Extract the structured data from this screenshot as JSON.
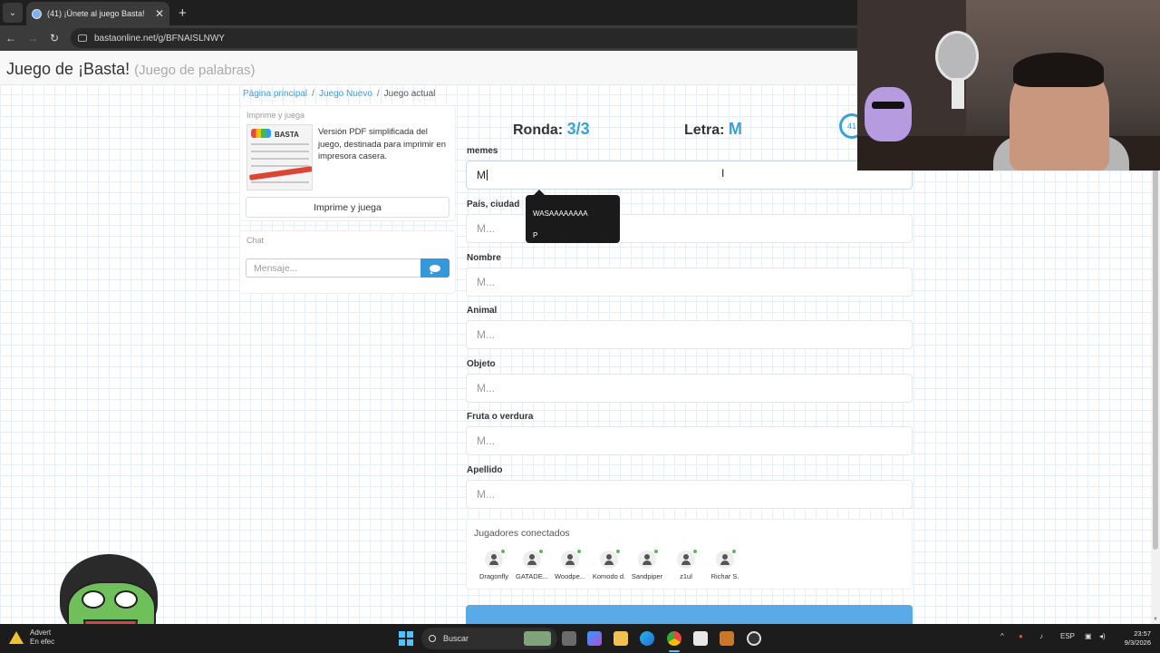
{
  "browser": {
    "tab_title": "(41) ¡Únete al juego Basta!",
    "url": "bastaonline.net/g/BFNAISLNWY",
    "tab_close": "✕",
    "tab_new": "+",
    "back": "←",
    "forward": "→",
    "reload": "↻",
    "menu": "⌄"
  },
  "site": {
    "title": "Juego de ¡Basta!",
    "subtitle": "(Juego de palabras)"
  },
  "breadcrumb": {
    "home": "Página principal",
    "new_game": "Juego Nuevo",
    "current": "Juego actual",
    "separator": "/"
  },
  "print_panel": {
    "heading": "Imprime y juega",
    "thumb_title": "BASTA",
    "description": "Versión PDF simplificada del juego, destinada para imprimir en impresora casera.",
    "button": "Imprime y juega"
  },
  "chat": {
    "heading": "Chat",
    "placeholder": "Mensaje..."
  },
  "game": {
    "round_label": "Ronda:",
    "round_value": "3/3",
    "letter_label": "Letra:",
    "letter_value": "M",
    "timer": "41"
  },
  "fields": [
    {
      "label": "memes",
      "value": "M",
      "placeholder": "M..."
    },
    {
      "label": "País, ciudad",
      "value": "",
      "placeholder": "M..."
    },
    {
      "label": "Nombre",
      "value": "",
      "placeholder": "M..."
    },
    {
      "label": "Animal",
      "value": "",
      "placeholder": "M..."
    },
    {
      "label": "Objeto",
      "value": "",
      "placeholder": "M..."
    },
    {
      "label": "Fruta o verdura",
      "value": "",
      "placeholder": "M..."
    },
    {
      "label": "Apellido",
      "value": "",
      "placeholder": "M..."
    }
  ],
  "tooltip": {
    "line1": "WASAAAAAAAA",
    "line2": "P"
  },
  "players": {
    "title": "Jugadores conectados",
    "list": [
      "Dragonfly",
      "GATADE...",
      "Woodpe...",
      "Komodo d.",
      "Sandpiper",
      "z1ul",
      "Richar S."
    ]
  },
  "taskbar": {
    "warning_line1": "Advert",
    "warning_line2": "En efec",
    "search": "Buscar",
    "lang": "ESP",
    "time": "23:57",
    "date": "9/3/2026"
  },
  "colors": {
    "accent": "#3aa0d8",
    "send_button": "#3498db",
    "online": "#5cb85c",
    "taskbar": "#1c1c1c"
  }
}
